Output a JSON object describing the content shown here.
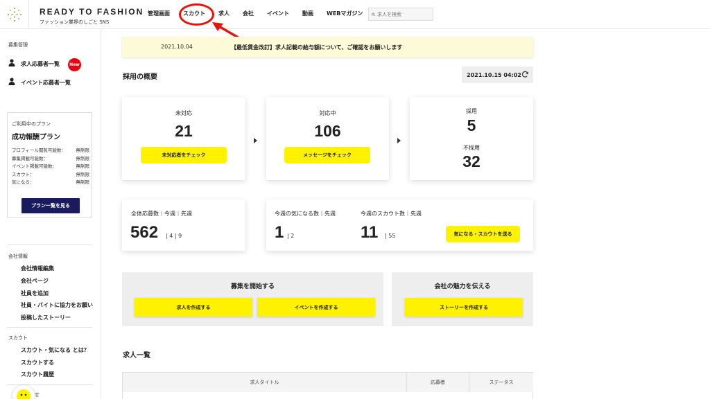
{
  "header": {
    "brand_title": "READY TO FASHION",
    "brand_subtitle": "ファッション業界のしごと SNS",
    "nav": [
      "管理画面",
      "スカウト",
      "求人",
      "会社",
      "イベント",
      "動画",
      "WEBマガジン"
    ],
    "search_placeholder": "求人を検索"
  },
  "sidebar": {
    "section_recruit": "募集管理",
    "applicants_link": "求人応募者一覧",
    "new_badge": "New",
    "event_applicants_link": "イベント応募者一覧",
    "plan": {
      "caption": "ご利用中のプラン",
      "name": "成功報酬プラン",
      "rows": [
        {
          "label": "プロフィール閲覧可能数：",
          "value": "無制限"
        },
        {
          "label": "募集掲載可能数：",
          "value": "無制限"
        },
        {
          "label": "イベント掲載可能数：",
          "value": "無制限"
        },
        {
          "label": "スカウト：",
          "value": "無制限"
        },
        {
          "label": "気になる：",
          "value": "無制限"
        }
      ],
      "button": "プラン一覧を見る"
    },
    "section_company": "会社情報",
    "company_links": [
      "会社情報編集",
      "会社ページ",
      "社員を追加",
      "社員・バイトに協力をお願い",
      "投稿したストーリー"
    ],
    "section_scout": "スカウト",
    "scout_links": [
      "スカウト・気になる とは？",
      "スカウトする",
      "スカウト履歴"
    ],
    "section_partial": "せ"
  },
  "notice": {
    "date": "2021.10.04",
    "text": "【最低賃金改訂】求人記載の給与額について、ご確認をお願いします"
  },
  "overview": {
    "title": "採用の概要",
    "datetime": "2021.10.15 04:02",
    "unhandled": {
      "label": "未対応",
      "count": "21",
      "button": "未対応者をチェック"
    },
    "in_progress": {
      "label": "対応中",
      "count": "106",
      "button": "メッセージをチェック"
    },
    "hired": {
      "label": "採用",
      "count": "5"
    },
    "rejected": {
      "label": "不採用",
      "count": "32"
    }
  },
  "stats": {
    "total_label": "全体応募数｜今週｜先週",
    "total": "562",
    "total_week": "4",
    "total_last": "9",
    "fav_label": "今週の気になる数｜先週",
    "fav": "1",
    "fav_last": "2",
    "scout_label": "今週のスカウト数｜先週",
    "scout": "11",
    "scout_last": "55",
    "send_button": "気になる・スカウトを送る"
  },
  "start_panel": {
    "title": "募集を開始する",
    "create_job": "求人を作成する",
    "create_event": "イベントを作成する"
  },
  "appeal_panel": {
    "title": "会社の魅力を伝える",
    "create_story": "ストーリーを作成する"
  },
  "jobs": {
    "title": "求人一覧",
    "columns": [
      "求人タイトル",
      "応募者",
      "ステータス"
    ]
  },
  "colors": {
    "accent_yellow": "#fff200",
    "annotation_red": "#e8140c",
    "plan_button": "#1a1a5e",
    "badge_red": "#e60012"
  }
}
